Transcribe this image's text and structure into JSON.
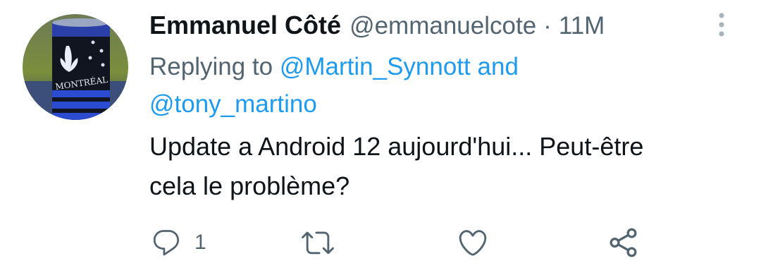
{
  "author": {
    "name": "Emmanuel Côté",
    "handle": "@emmanuelcote",
    "separator": "·",
    "time": "11M"
  },
  "reply": {
    "prefix": "Replying to",
    "mention1": "@Martin_Synnott",
    "conjunction": "and",
    "mention2": "@tony_martino"
  },
  "tweet": {
    "line1": "Update a Android 12 aujourd'hui... Peut-être",
    "line2": "cela le problème?"
  },
  "actions": {
    "reply_count": "1",
    "retweet_count": "",
    "like_count": ""
  },
  "avatar": {
    "can_text": "MONTRÉAL"
  },
  "colors": {
    "text": "#0f1419",
    "muted": "#536471",
    "link": "#1d9bf0"
  },
  "icons": {
    "reply": "reply-icon",
    "retweet": "retweet-icon",
    "like": "heart-icon",
    "share": "share-icon",
    "more": "more-vertical-icon"
  }
}
